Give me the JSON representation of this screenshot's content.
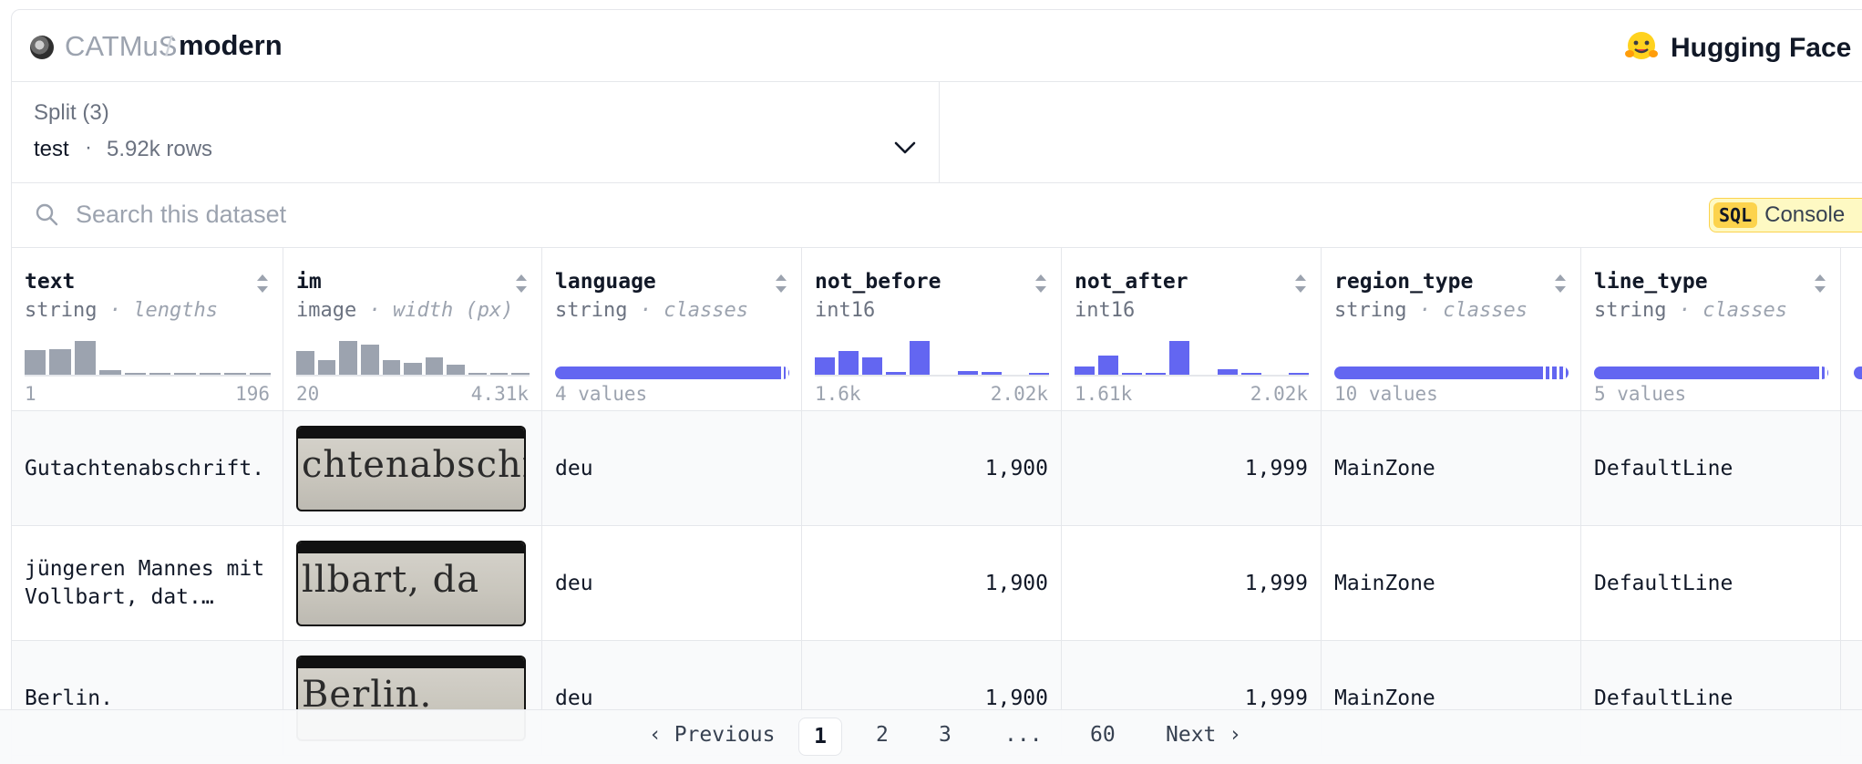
{
  "header": {
    "org": "CATMuS",
    "separator": "/",
    "repo": "modern",
    "brand": "Hugging Face"
  },
  "split": {
    "label": "Split (3)",
    "name": "test",
    "dot": "·",
    "rows": "5.92k rows"
  },
  "search": {
    "placeholder": "Search this dataset",
    "sql_tag": "SQL",
    "console_label": "Console"
  },
  "columns": [
    {
      "name": "text",
      "type": "string",
      "stat": "· lengths",
      "min": "1",
      "max": "196",
      "hist": [
        0.7,
        0.72,
        0.95,
        0.15,
        0.05,
        0.04,
        0.03,
        0.03,
        0.03,
        0.03
      ],
      "color": "#9ca3af"
    },
    {
      "name": "im",
      "type": "image",
      "stat": "· width (px)",
      "min": "20",
      "max": "4.31k",
      "hist": [
        0.68,
        0.42,
        0.95,
        0.85,
        0.42,
        0.35,
        0.5,
        0.3,
        0.08,
        0.04,
        0.03
      ],
      "color": "#9ca3af"
    },
    {
      "name": "language",
      "type": "string",
      "stat": "· classes",
      "values": "4 values"
    },
    {
      "name": "not_before",
      "type": "int16",
      "stat": "",
      "min": "1.6k",
      "max": "2.02k",
      "hist": [
        0.5,
        0.68,
        0.5,
        0.1,
        0.95,
        0.0,
        0.12,
        0.1,
        0.0,
        0.08
      ],
      "color": "#6366f1"
    },
    {
      "name": "not_after",
      "type": "int16",
      "stat": "",
      "min": "1.61k",
      "max": "2.02k",
      "hist": [
        0.25,
        0.55,
        0.05,
        0.05,
        0.95,
        0.0,
        0.18,
        0.08,
        0.0,
        0.06
      ],
      "color": "#6366f1"
    },
    {
      "name": "region_type",
      "type": "string",
      "stat": "· classes",
      "values": "10 values"
    },
    {
      "name": "line_type",
      "type": "string",
      "stat": "· classes",
      "values": "5 values"
    }
  ],
  "rows": [
    {
      "text": "Gutachtenabschrift.",
      "image_text": "chtenabschr",
      "language": "deu",
      "not_before": "1,900",
      "not_after": "1,999",
      "region_type": "MainZone",
      "line_type": "DefaultLine"
    },
    {
      "text": "jüngeren Mannes mit Vollbart, dat.…",
      "image_text": "llbart, da",
      "language": "deu",
      "not_before": "1,900",
      "not_after": "1,999",
      "region_type": "MainZone",
      "line_type": "DefaultLine"
    },
    {
      "text": "Berlin.",
      "image_text": "Berlin.",
      "language": "deu",
      "not_before": "1,900",
      "not_after": "1,999",
      "region_type": "MainZone",
      "line_type": "DefaultLine"
    }
  ],
  "pagination": {
    "previous": "Previous",
    "pages": [
      "1",
      "2",
      "3",
      "...",
      "60"
    ],
    "next": "Next",
    "current": "1"
  }
}
